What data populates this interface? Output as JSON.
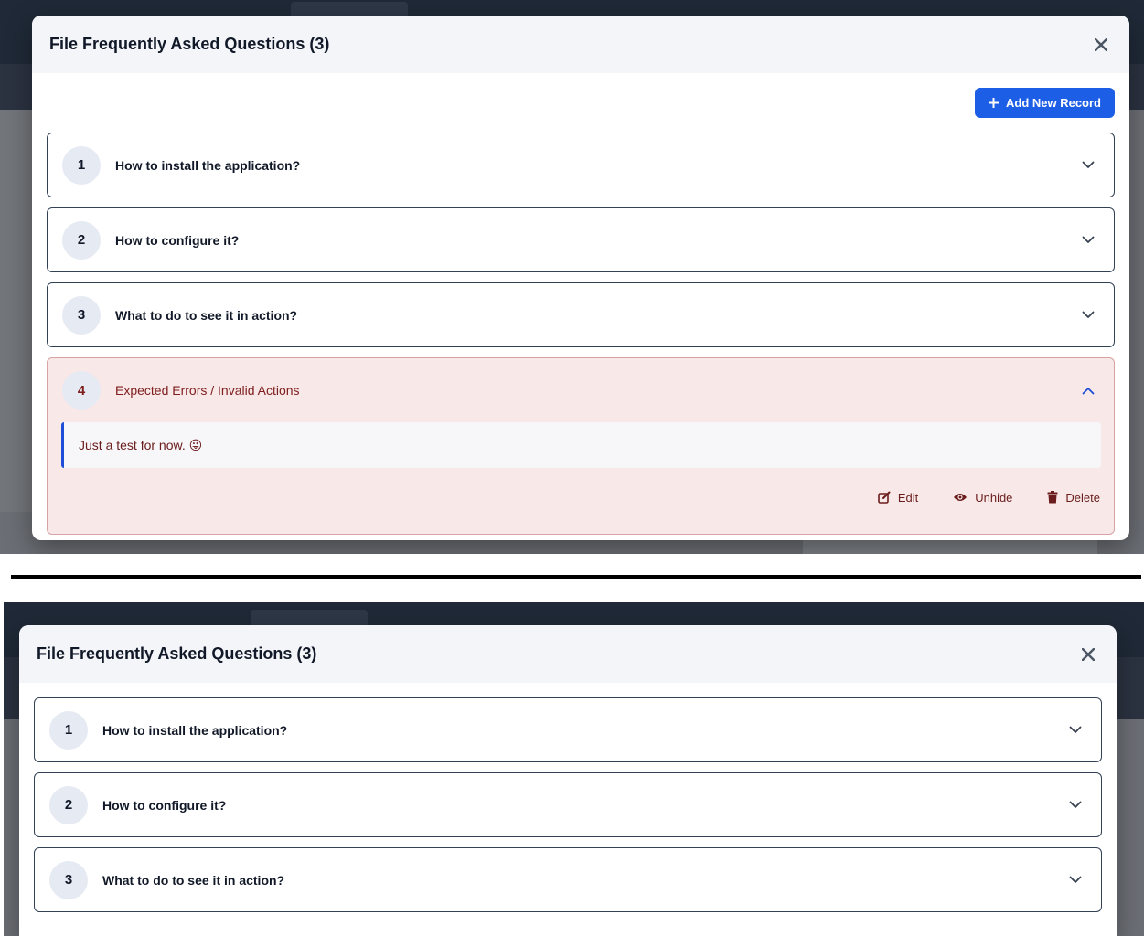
{
  "screens": [
    {
      "dialog": {
        "title": "File Frequently Asked Questions (3)",
        "add_button_label": "Add New Record",
        "items": [
          {
            "number": "1",
            "question": "How to install the application?",
            "expanded": false
          },
          {
            "number": "2",
            "question": "How to configure it?",
            "expanded": false
          },
          {
            "number": "3",
            "question": "What to do to see it in action?",
            "expanded": false
          },
          {
            "number": "4",
            "question": "Expected Errors / Invalid Actions",
            "expanded": true,
            "answer": "Just a test for now. 😜",
            "actions": {
              "edit": "Edit",
              "unhide": "Unhide",
              "delete": "Delete"
            }
          }
        ]
      }
    },
    {
      "dialog": {
        "title": "File Frequently Asked Questions (3)",
        "items": [
          {
            "number": "1",
            "question": "How to install the application?",
            "expanded": false
          },
          {
            "number": "2",
            "question": "How to configure it?",
            "expanded": false
          },
          {
            "number": "3",
            "question": "What to do to see it in action?",
            "expanded": false
          }
        ]
      }
    }
  ],
  "colors": {
    "accent": "#1d5ee6",
    "header_bg": "#f3f5f9",
    "error_bg": "#f8e8e8",
    "error_text": "#7f1d1d",
    "item_border": "#334155"
  },
  "icons": [
    "close-icon",
    "plus-icon",
    "chevron-down-icon",
    "chevron-up-icon",
    "edit-icon",
    "eye-icon",
    "trash-icon"
  ]
}
